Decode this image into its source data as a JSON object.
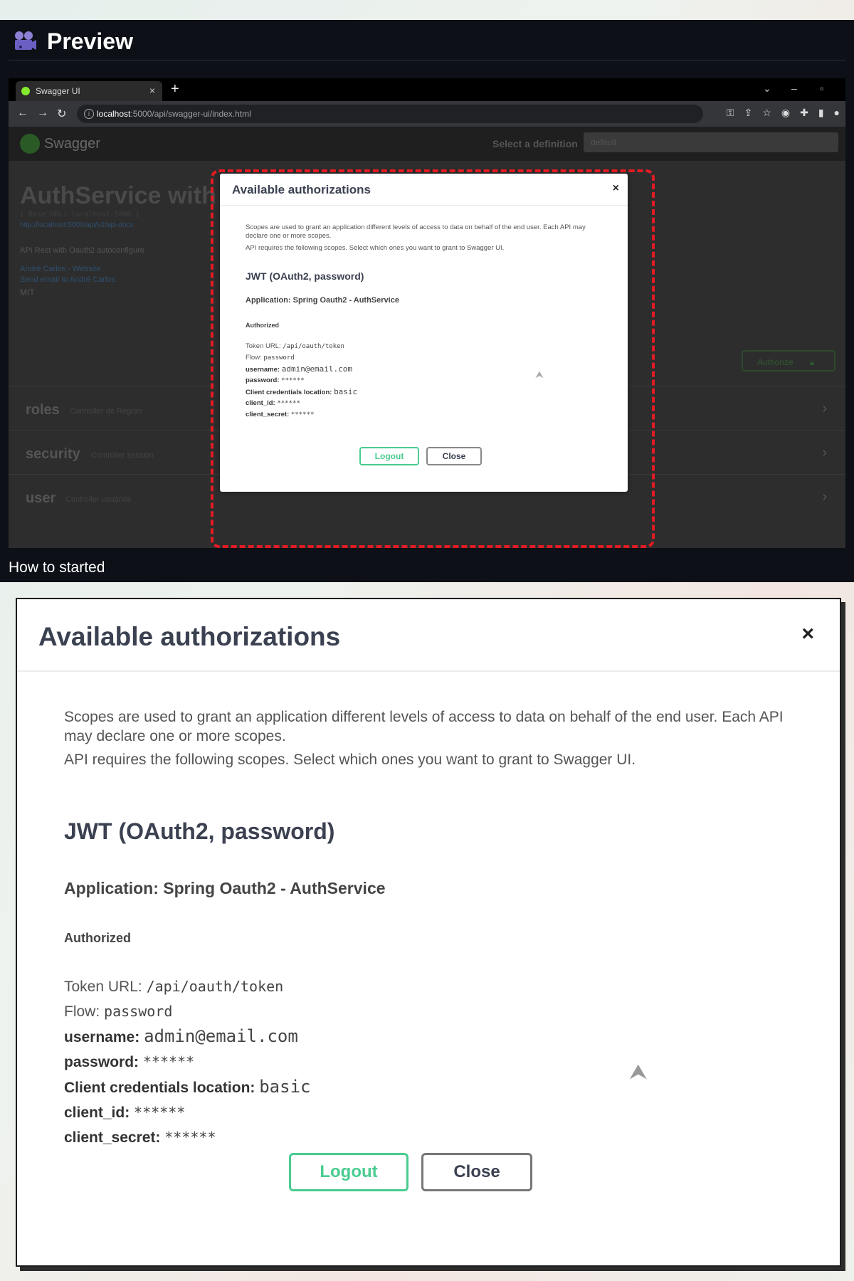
{
  "preview": {
    "title": "Preview",
    "caption": "How to started",
    "icon": "camera-icon"
  },
  "browser": {
    "tab_title": "Swagger UI",
    "tab_close": "×",
    "new_tab": "+",
    "url_host": "localhost",
    "url_path": ":5000/api/swagger-ui/index.html"
  },
  "swagger": {
    "logo_text": "Swagger",
    "select_definition_label": "Select a definition",
    "select_definition_value": "default",
    "api_title": "AuthService with S",
    "base_url": "[ Base URL: localhost:5000 ]",
    "api_docs_url": "http://localhost:5000/api/v2/api-docs",
    "description": "API Rest with Oauth2 autoconfigure",
    "contact_website": "André Carlos - Website",
    "contact_email": "Send email to André Carlos",
    "license": "MIT",
    "authorize_label": "Authorize",
    "sections": [
      {
        "name": "roles",
        "desc": "Controller de Regras"
      },
      {
        "name": "security",
        "desc": "Controller session"
      },
      {
        "name": "user",
        "desc": "Controller usuários"
      }
    ]
  },
  "modal": {
    "title": "Available authorizations",
    "close_x": "×",
    "scope_text_1": "Scopes are used to grant an application different levels of access to data on behalf of the end user. Each API may declare one or more scopes.",
    "scope_text_2": "API requires the following scopes. Select which ones you want to grant to Swagger UI.",
    "scheme_heading": "JWT (OAuth2, password)",
    "application": "Application: Spring Oauth2 - AuthService",
    "authorized": "Authorized",
    "token_url_label": "Token URL:",
    "token_url_value": "/api/oauth/token",
    "flow_label": "Flow:",
    "flow_value": "password",
    "username_label": "username:",
    "username_value": "admin@email.com",
    "password_label": "password:",
    "password_value": "******",
    "client_location_label": "Client credentials location:",
    "client_location_value": "basic",
    "client_id_label": "client_id:",
    "client_id_value": "******",
    "client_secret_label": "client_secret:",
    "client_secret_value": "******",
    "logout_label": "Logout",
    "close_label": "Close"
  },
  "colors": {
    "highlight": "#e31b23",
    "logout_green": "#49cc90",
    "preview_bg": "#0d1117"
  }
}
